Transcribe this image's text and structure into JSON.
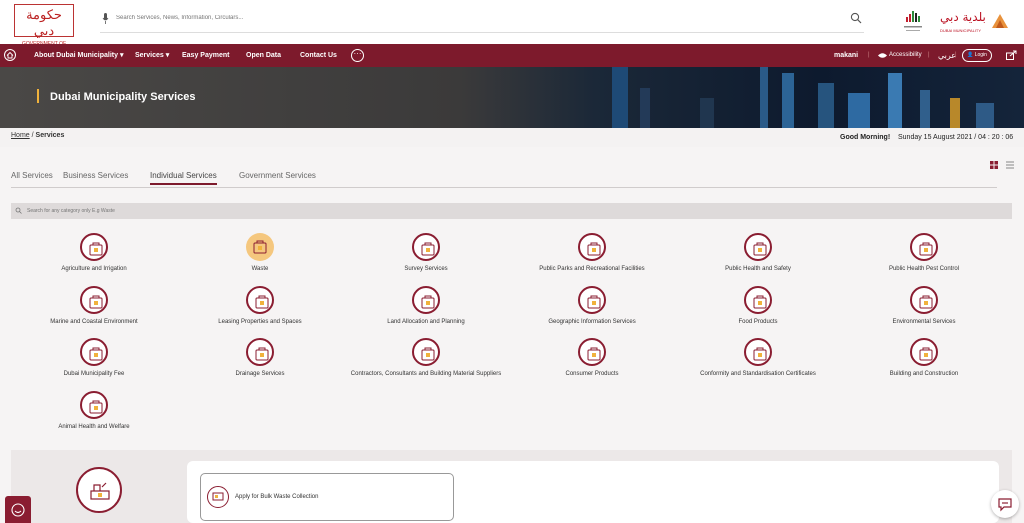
{
  "header": {
    "gov_logo_ar": "حكومة دبي",
    "gov_logo_en": "GOVERNMENT OF DUBAI",
    "search_placeholder": "Search Services, News, Information, Circulars...",
    "dm_logo_ar": "بلدية دبي",
    "dm_logo_en": "DUBAI MUNICIPALITY"
  },
  "nav": {
    "items": [
      "About Dubai Municipality",
      "Services",
      "Easy Payment",
      "Open Data",
      "Contact Us"
    ],
    "more_label": "···",
    "makani": "makani",
    "accessibility": "Accessibility",
    "language": "عربي",
    "login": "Login"
  },
  "hero": {
    "title": "Dubai Municipality Services"
  },
  "breadcrumb": {
    "home": "Home",
    "current": "Services"
  },
  "greeting": "Good Morning!",
  "datetime": "Sunday 15 August 2021 / 04 : 20 : 06",
  "tabs": [
    "All Services",
    "Business Services",
    "Individual Services",
    "Government Services"
  ],
  "active_tab": "Individual Services",
  "filter_placeholder": "Search for any category only E.g Waste",
  "categories": [
    "Agriculture and Irrigation",
    "Waste",
    "Survey Services",
    "Public Parks and Recreational Facilities",
    "Public Health and Safety",
    "Public Health Pest Control",
    "Marine and Coastal Environment",
    "Leasing Properties and Spaces",
    "Land Allocation and Planning",
    "Geographic Information Services",
    "Food Products",
    "Environmental Services",
    "Dubai Municipality Fee",
    "Drainage Services",
    "Contractors, Consultants and Building Material Suppliers",
    "Consumer Products",
    "Conformity and Standardisation Certificates",
    "Building and Construction",
    "Animal Health and Welfare"
  ],
  "selected_category": "Waste",
  "service_card": "Apply for Bulk Waste Collection",
  "colors": {
    "brand": "#7d1a2c",
    "accent": "#f0b23c",
    "selected": "#f5c77e"
  }
}
